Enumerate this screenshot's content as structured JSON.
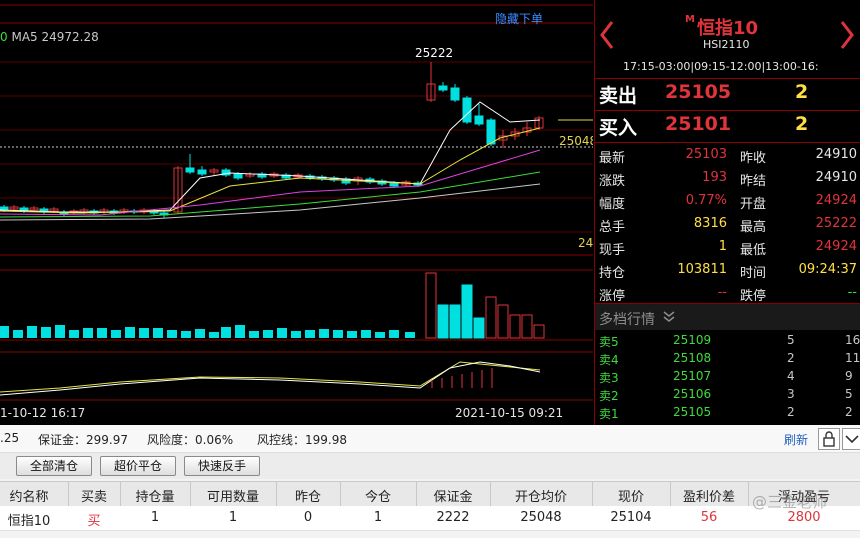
{
  "chart": {
    "hide_link": "隐藏下单",
    "ma_legend_prefix": "0",
    "ma_legend": "MA5 24972.28",
    "high_label": "25222",
    "last_price_label": "25048",
    "partial_axis_label": "24",
    "date_left": "1-10-12 16:17",
    "date_right": "2021-10-15 09:21",
    "colors": {
      "up": "#e0343c",
      "down": "#00e0e0",
      "ma5": "#ffffff",
      "ma10": "#e6e640",
      "ma20": "#e040e0",
      "ma30": "#3cdc3c",
      "ma60": "#c8c8c8"
    }
  },
  "quote": {
    "title_badge": "M",
    "title": "恒指10",
    "code": "HSI2110",
    "hours": "17:15-03:00|09:15-12:00|13:00-16:",
    "sell_label": "卖出",
    "sell_price": "25105",
    "sell_vol": "2",
    "buy_label": "买入",
    "buy_price": "25101",
    "buy_vol": "2",
    "stats": [
      {
        "l1": "最新",
        "v1": "25103",
        "c1": "red",
        "l2": "昨收",
        "v2": "24910",
        "c2": "white"
      },
      {
        "l1": "涨跌",
        "v1": "193",
        "c1": "red",
        "l2": "昨结",
        "v2": "24910",
        "c2": "white"
      },
      {
        "l1": "幅度",
        "v1": "0.77%",
        "c1": "red",
        "l2": "开盘",
        "v2": "24924",
        "c2": "red"
      },
      {
        "l1": "总手",
        "v1": "8316",
        "c1": "yellow",
        "l2": "最高",
        "v2": "25222",
        "c2": "red"
      },
      {
        "l1": "现手",
        "v1": "1",
        "c1": "yellow",
        "l2": "最低",
        "v2": "24924",
        "c2": "red"
      },
      {
        "l1": "持仓",
        "v1": "103811",
        "c1": "yellow",
        "l2": "时间",
        "v2": "09:24:37",
        "c2": "yellow"
      },
      {
        "l1": "涨停",
        "v1": "--",
        "c1": "red",
        "l2": "跌停",
        "v2": "--",
        "c2": "green"
      }
    ],
    "depth_title": "多档行情",
    "depth": [
      {
        "label": "卖5",
        "price": "25109",
        "vol": "5",
        "extra": "16"
      },
      {
        "label": "卖4",
        "price": "25108",
        "vol": "2",
        "extra": "11"
      },
      {
        "label": "卖3",
        "price": "25107",
        "vol": "4",
        "extra": "9"
      },
      {
        "label": "卖2",
        "price": "25106",
        "vol": "3",
        "extra": "5"
      },
      {
        "label": "卖1",
        "price": "25105",
        "vol": "2",
        "extra": "2"
      }
    ]
  },
  "account": {
    "balance_fragment": ".25",
    "margin": "保证金：299.97",
    "risk": "风险度：0.06%",
    "risk_line": "风控线：199.98",
    "refresh": "刷新"
  },
  "buttons": {
    "close_all": "全部清仓",
    "close_over": "超价平仓",
    "reverse": "快速反手"
  },
  "positions": {
    "headers": [
      "约名称",
      "买卖",
      "持仓量",
      "可用数量",
      "昨仓",
      "今仓",
      "保证金",
      "开仓均价",
      "现价",
      "盈利价差",
      "浮动盈亏"
    ],
    "rows": [
      [
        "恒指10",
        "买",
        "1",
        "1",
        "0",
        "1",
        "2222",
        "25048",
        "25104",
        "56",
        "2800"
      ]
    ]
  },
  "watermark": "@三金老师"
}
